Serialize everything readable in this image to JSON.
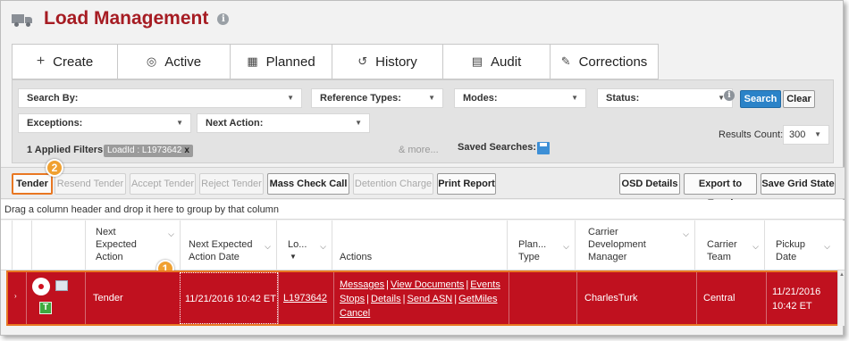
{
  "header": {
    "title": "Load Management",
    "truck_icon": "truck-icon",
    "info_icon": "i"
  },
  "tabs": [
    {
      "label": "Create",
      "icon": "+"
    },
    {
      "label": "Active",
      "icon": "◎"
    },
    {
      "label": "Planned",
      "icon": "▦"
    },
    {
      "label": "History",
      "icon": "↺"
    },
    {
      "label": "Audit",
      "icon": "▤"
    },
    {
      "label": "Corrections",
      "icon": "✎"
    }
  ],
  "filters": {
    "search_by": "Search By:",
    "reference_types": "Reference Types:",
    "modes": "Modes:",
    "status": "Status:",
    "exceptions": "Exceptions:",
    "next_action": "Next Action:",
    "search_button": "Search",
    "clear_button": "Clear",
    "applied_filters_label": "1 Applied Filters:",
    "applied_chip": "LoadId : L1973642",
    "chip_remove": "x",
    "more": "& more...",
    "saved_searches": "Saved Searches:",
    "results_count_label": "Results Count:",
    "results_count_value": "300"
  },
  "toolbar": {
    "tender": "Tender",
    "resend_tender": "Resend Tender",
    "accept_tender": "Accept Tender",
    "reject_tender": "Reject Tender",
    "mass_check_call": "Mass Check Call",
    "detention_charge": "Detention Charge",
    "print_report": "Print Report",
    "osd_details": "OSD Details",
    "export_excel": "Export to Excel",
    "save_grid_state": "Save Grid State"
  },
  "callouts": {
    "one": "1",
    "two": "2"
  },
  "grid": {
    "group_hint": "Drag a column header and drop it here to group by that column",
    "headers": {
      "next_expected_action": [
        "Next",
        "Expected",
        "Action"
      ],
      "next_expected_action_date": [
        "Next Expected",
        "Action Date"
      ],
      "load": "Lo...",
      "actions": "Actions",
      "plan_type": [
        "Plan...",
        "Type"
      ],
      "carrier_dev_manager": [
        "Carrier",
        "Development",
        "Manager"
      ],
      "carrier_team": [
        "Carrier",
        "Team"
      ],
      "pickup_date": [
        "Pickup",
        "Date"
      ]
    },
    "row": {
      "tender_icon_letter": "T",
      "next_action": "Tender",
      "next_action_date": "11/21/2016 10:42 ET",
      "load_id": "L1973642",
      "actions": [
        "Messages",
        "View Documents",
        "Events",
        "Stops",
        "Details",
        "Send ASN",
        "GetMiles",
        "Cancel"
      ],
      "plan_type": "",
      "manager": "CharlesTurk",
      "team": "Central",
      "pickup_line1": "11/21/2016",
      "pickup_line2": "10:42 ET"
    }
  }
}
